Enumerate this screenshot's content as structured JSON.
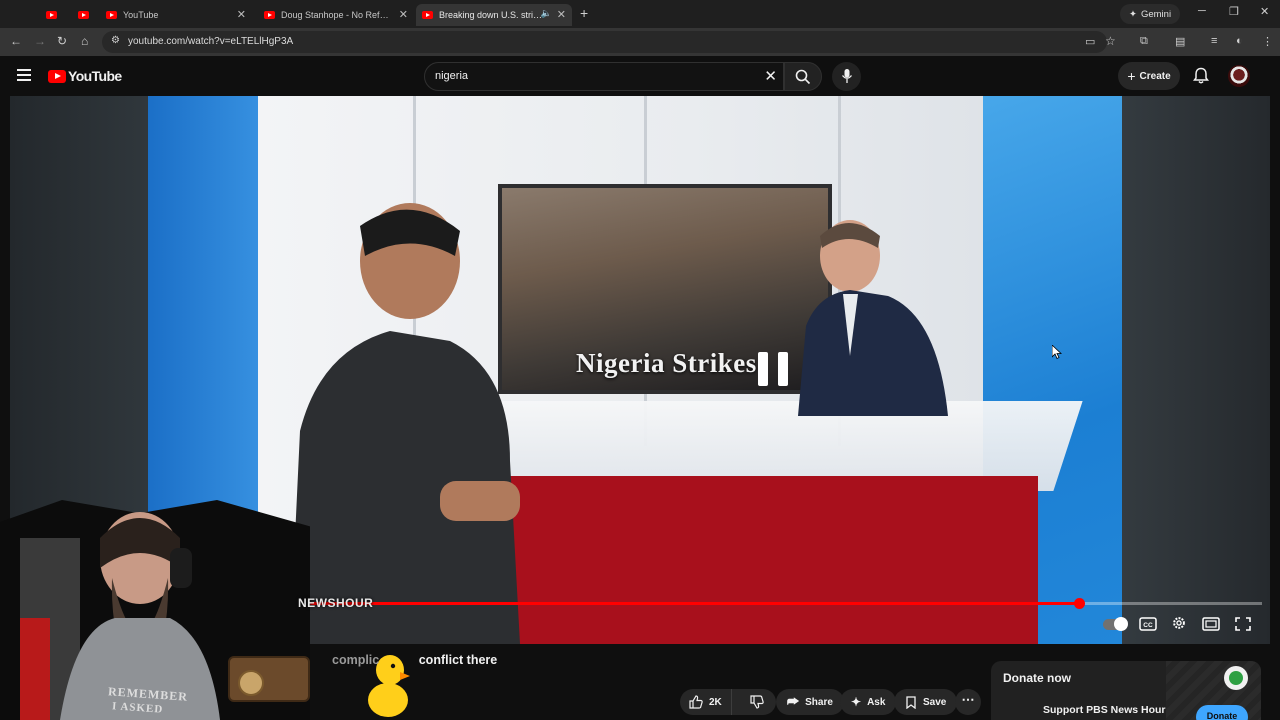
{
  "browser": {
    "tabs": [
      {
        "label": ""
      },
      {
        "label": ""
      },
      {
        "label": "YouTube"
      },
      {
        "label": "Doug Stanhope - No Refunds -"
      },
      {
        "label": "Breaking down U.S. strikes i"
      }
    ],
    "gemini_label": "Gemini",
    "url": "youtube.com/watch?v=eLTELlHgP3A"
  },
  "youtube": {
    "logo_text": "YouTube",
    "search_value": "nigeria",
    "create_label": "Create"
  },
  "video": {
    "on_screen_graphic": "Nigeria Strikes",
    "overlay_show_name": "NEWSHOUR",
    "streamer_shirt_line1": "REMEMBER",
    "streamer_shirt_line2": "I ASKED",
    "progress_fraction": 0.81,
    "state": "paused"
  },
  "caption": {
    "dim_text": "complic",
    "text": "conflict there"
  },
  "actions": {
    "like_count": "2K",
    "share_label": "Share",
    "ask_label": "Ask",
    "save_label": "Save"
  },
  "donate": {
    "title": "Donate now",
    "subtitle": "Support PBS News Hour",
    "button": "Donate"
  },
  "colors": {
    "accent": "#ff0000",
    "background": "#0f0f0f",
    "link_blue": "#3ea6ff"
  }
}
